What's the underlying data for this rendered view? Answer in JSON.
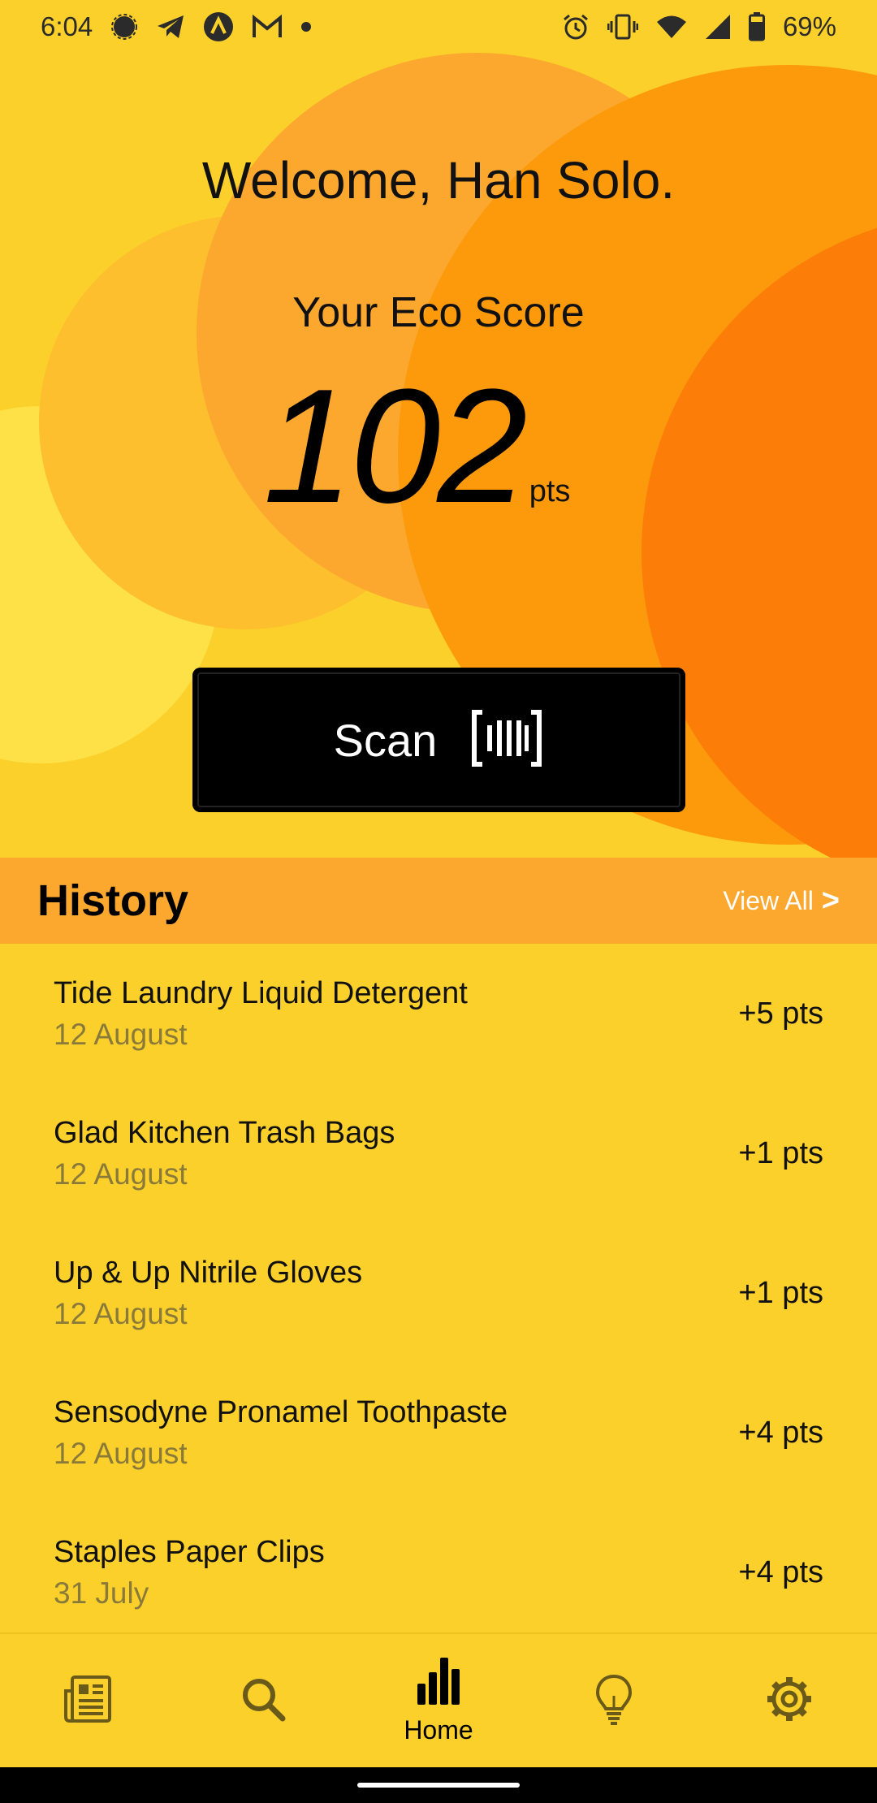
{
  "status_bar": {
    "time": "6:04",
    "battery": "69%",
    "left_icons": [
      "signal-messenger-icon",
      "telegram-icon",
      "arc-icon",
      "gmail-icon",
      "dot-icon"
    ],
    "right_icons": [
      "alarm-icon",
      "vibrate-icon",
      "wifi-icon",
      "cell-signal-icon",
      "battery-icon"
    ]
  },
  "hero": {
    "welcome": "Welcome, Han Solo.",
    "score_label": "Your Eco Score",
    "score_value": "102",
    "score_unit": "pts"
  },
  "scan_button": {
    "label": "Scan",
    "icon": "barcode-icon"
  },
  "history": {
    "title": "History",
    "view_all": "View All",
    "view_all_icon": ">",
    "items": [
      {
        "name": "Tide Laundry Liquid Detergent",
        "date": "12 August",
        "points": "+5 pts"
      },
      {
        "name": "Glad Kitchen Trash Bags",
        "date": "12 August",
        "points": "+1 pts"
      },
      {
        "name": "Up & Up Nitrile Gloves",
        "date": "12 August",
        "points": "+1 pts"
      },
      {
        "name": "Sensodyne Pronamel Toothpaste",
        "date": "12 August",
        "points": "+4 pts"
      },
      {
        "name": "Staples Paper Clips",
        "date": "31 July",
        "points": "+4 pts"
      }
    ]
  },
  "bottom_nav": {
    "items": [
      {
        "icon": "news-icon",
        "label": ""
      },
      {
        "icon": "search-icon",
        "label": ""
      },
      {
        "icon": "bar-chart-icon",
        "label": "Home"
      },
      {
        "icon": "lightbulb-icon",
        "label": ""
      },
      {
        "icon": "gear-icon",
        "label": ""
      }
    ],
    "active": "Home"
  },
  "colors": {
    "background": "#FCD02A",
    "history_bar": "#FCA72E",
    "orange_deep": "#FC7E08",
    "button": "#000000"
  }
}
